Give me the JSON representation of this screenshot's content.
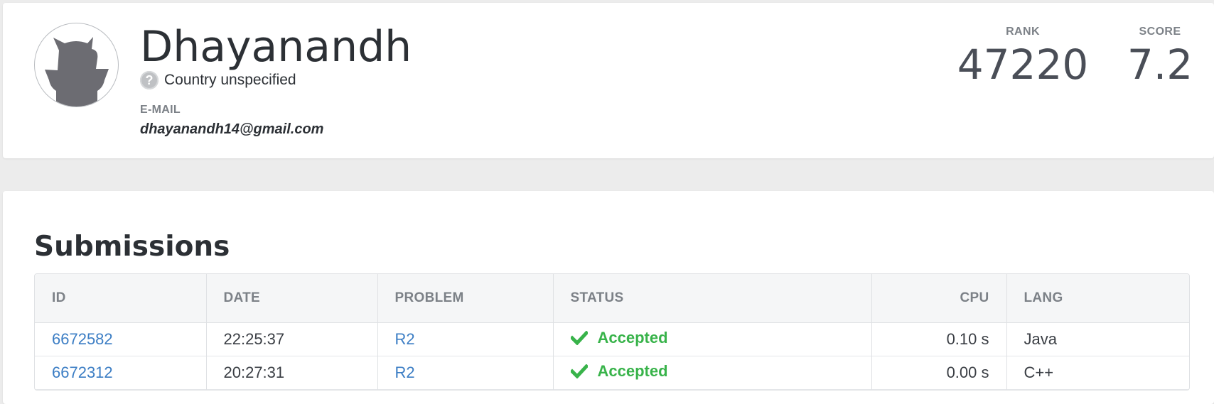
{
  "profile": {
    "name": "Dhayanandh",
    "country": "Country unspecified",
    "country_icon": "?",
    "email_label": "E-MAIL",
    "email": "dhayanandh14@gmail.com",
    "avatar_icon": "cat-silhouette-icon"
  },
  "stats": {
    "rank_label": "RANK",
    "rank_value": "47220",
    "score_label": "SCORE",
    "score_value": "7.2"
  },
  "submissions": {
    "title": "Submissions",
    "columns": [
      "ID",
      "DATE",
      "PROBLEM",
      "STATUS",
      "CPU",
      "LANG"
    ],
    "rows": [
      {
        "id": "6672582",
        "date": "22:25:37",
        "problem": "R2",
        "status": "Accepted",
        "cpu": "0.10 s",
        "lang": "Java"
      },
      {
        "id": "6672312",
        "date": "20:27:31",
        "problem": "R2",
        "status": "Accepted",
        "cpu": "0.00 s",
        "lang": "C++"
      }
    ]
  },
  "colors": {
    "accent_link": "#3b7dc4",
    "status_accepted": "#38b34a",
    "page_background": "#ececec"
  }
}
